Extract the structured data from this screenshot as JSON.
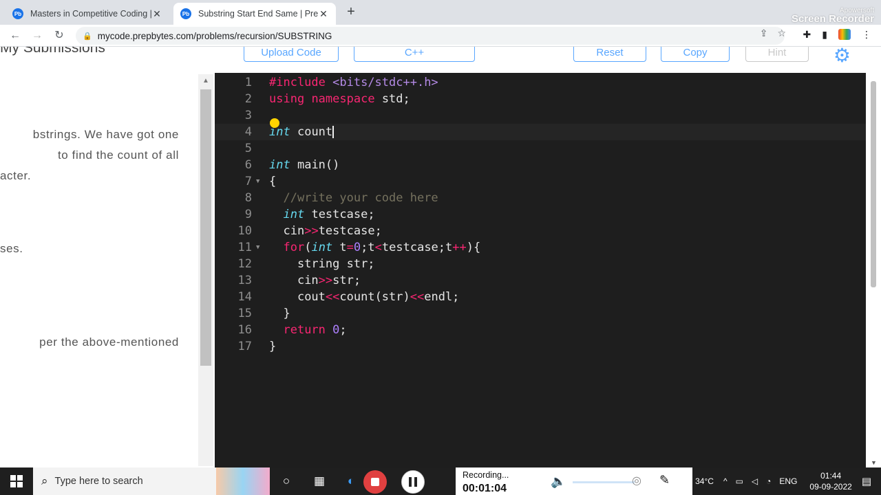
{
  "browser": {
    "tabs": [
      {
        "title": "Masters in Competitive Coding |",
        "favicon": "Pb",
        "active": false
      },
      {
        "title": "Substring Start End Same | PrepB",
        "favicon": "Pb",
        "active": true
      }
    ],
    "new_tab": "+",
    "url": "mycode.prepbytes.com/problems/recursion/SUBSTRING",
    "recorder_watermark": {
      "line1": "Apowersoft",
      "line2": "Screen Recorder"
    }
  },
  "problem": {
    "heading": "My Submissions",
    "lines": [
      "bstrings. We have got one",
      "to find the count of all",
      "acter.",
      "ses.",
      "per the above-mentioned"
    ]
  },
  "editor_toolbar": {
    "upload": "Upload Code",
    "language": "C++",
    "reset": "Reset",
    "copy": "Copy",
    "hint": "Hint"
  },
  "code": {
    "line_numbers": [
      "1",
      "2",
      "3",
      "4",
      "5",
      "6",
      "7",
      "8",
      "9",
      "10",
      "11",
      "12",
      "13",
      "14",
      "15",
      "16",
      "17"
    ],
    "line1": {
      "directive": "#include",
      "header": "<bits/stdc++.h>"
    },
    "line2": {
      "kw1": "using",
      "kw2": "namespace",
      "rest": "std;"
    },
    "line4": {
      "type": "int",
      "rest": "count"
    },
    "line6": {
      "type": "int",
      "rest": "main()"
    },
    "line7": "{",
    "line8": "//write your code here",
    "line9": {
      "type": "int",
      "rest": "testcase;"
    },
    "line10": {
      "a": "cin",
      "op": ">>",
      "b": "testcase;"
    },
    "line11": {
      "kw": "for",
      "p1": "(",
      "type": "int",
      "t1": "t",
      "op1": "=",
      "n0": "0",
      "s1": ";t",
      "op2": "<",
      "s2": "testcase;t",
      "op3": "++",
      "end": "){"
    },
    "line12": "string str;",
    "line13": {
      "a": "cin",
      "op": ">>",
      "b": "str;"
    },
    "line14": {
      "a": "cout",
      "op1": "<<",
      "b": "count(str)",
      "op2": "<<",
      "c": "endl;"
    },
    "line15": "}",
    "line16": {
      "kw": "return",
      "num": "0",
      "rest": ";"
    },
    "line17": "}"
  },
  "taskbar": {
    "search_placeholder": "Type here to search",
    "recording_label": "Recording...",
    "recording_time": "00:01:04",
    "temperature": "34°C",
    "language": "ENG",
    "time": "01:44",
    "date": "09-09-2022"
  }
}
